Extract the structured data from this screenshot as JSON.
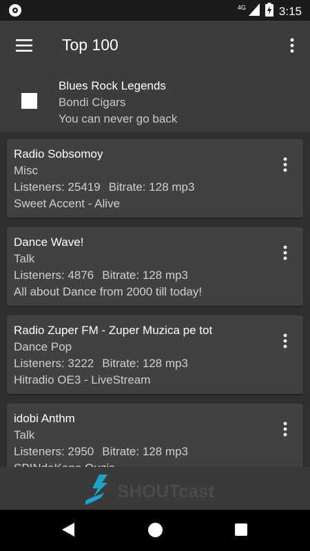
{
  "status_bar": {
    "network": "4G",
    "time": "3:15",
    "icons": [
      "app-notification-icon",
      "signal-icon",
      "battery-charging-icon"
    ]
  },
  "app_bar": {
    "title": "Top 100",
    "menu_icon": "hamburger-menu-icon",
    "overflow_icon": "more-vert-icon"
  },
  "now_playing": {
    "station": "Blues Rock Legends",
    "artist": "Bondi Cigars",
    "track": "You can never go back"
  },
  "stations": [
    {
      "name": "Radio Sobsomoy",
      "genre": "Misc",
      "listeners": "Listeners: 25419",
      "bitrate": "Bitrate: 128 mp3",
      "now_playing": "Sweet Accent - Alive"
    },
    {
      "name": "Dance Wave!",
      "genre": "Talk",
      "listeners": "Listeners: 4876",
      "bitrate": "Bitrate: 128 mp3",
      "now_playing": "All about Dance from 2000 till today!"
    },
    {
      "name": "Radio Zuper FM - Zuper Muzica pe tot",
      "genre": "Dance Pop",
      "listeners": "Listeners: 3222",
      "bitrate": "Bitrate: 128 mp3",
      "now_playing": "Hitradio OE3 - LiveStream"
    },
    {
      "name": "idobi Anthm",
      "genre": "Talk",
      "listeners": "Listeners: 2950",
      "bitrate": "Bitrate: 128 mp3",
      "now_playing": "SPINdeKane Ouzis"
    }
  ],
  "footer": {
    "logo_text": "SHOUTcast",
    "logo_color": "#1ea1c9"
  },
  "nav_bar": {
    "icons": [
      "back-icon",
      "home-icon",
      "recents-icon"
    ]
  }
}
